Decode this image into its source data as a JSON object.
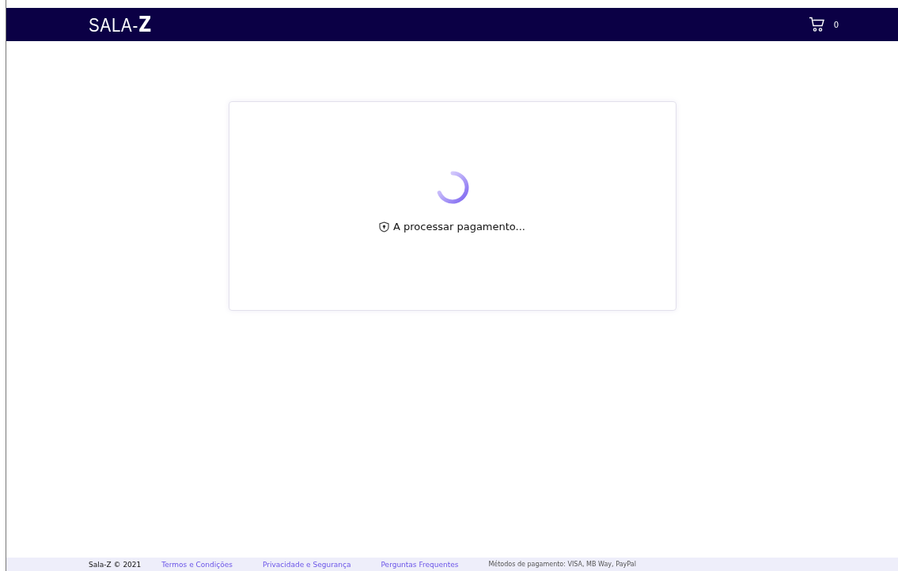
{
  "header": {
    "logo_text": "SALA-",
    "logo_mark": "Z",
    "cart_count": "0"
  },
  "status": {
    "message": "A processar pagamento..."
  },
  "footer": {
    "copyright": "Sala-Z © 2021",
    "links": [
      "Termos e Condições",
      "Privacidade e Segurança",
      "Perguntas Frequentes"
    ],
    "payment_methods": "Métodos de pagamento: VISA, MB Way, PayPal"
  }
}
